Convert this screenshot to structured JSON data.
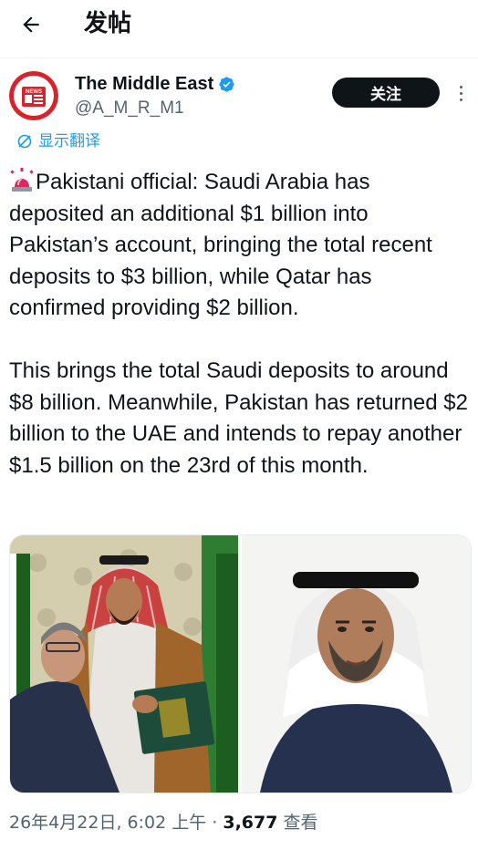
{
  "header": {
    "title": "发帖",
    "back_icon": "arrow-left-icon"
  },
  "author": {
    "name": "The Middle East",
    "handle": "@A_M_R_M1",
    "verified": true,
    "avatar_icon": "news-logo-icon",
    "avatar_text": "NEWS",
    "follow_label": "关注",
    "more_icon": "more-vertical-icon"
  },
  "translate": {
    "label": "显示翻译",
    "icon": "translate-icon"
  },
  "post": {
    "paragraph1": "Pakistani official: Saudi Arabia has deposited an additional $1 billion into Pakistan’s account, bringing the total recent deposits to $3 billion, while Qatar has confirmed providing $2 billion.",
    "paragraph2": "This brings the total Saudi deposits to around $8 billion. Meanwhile, Pakistan has returned $2 billion to the UAE and intends to repay another $1.5 billion on the 23rd of this month.",
    "emoji": "siren-emoji"
  },
  "media": {
    "photo_left": "photo-two-officials-holding-documents",
    "photo_right": "photo-man-in-white-headscarf"
  },
  "meta": {
    "datetime": "26年4月22日, 6:02 上午 · ",
    "views": "3,677",
    "views_label": " 查看"
  },
  "colors": {
    "accent": "#1d9bf0",
    "text": "#0f1419",
    "secondary": "#536471",
    "follow_bg": "#0f1419"
  }
}
